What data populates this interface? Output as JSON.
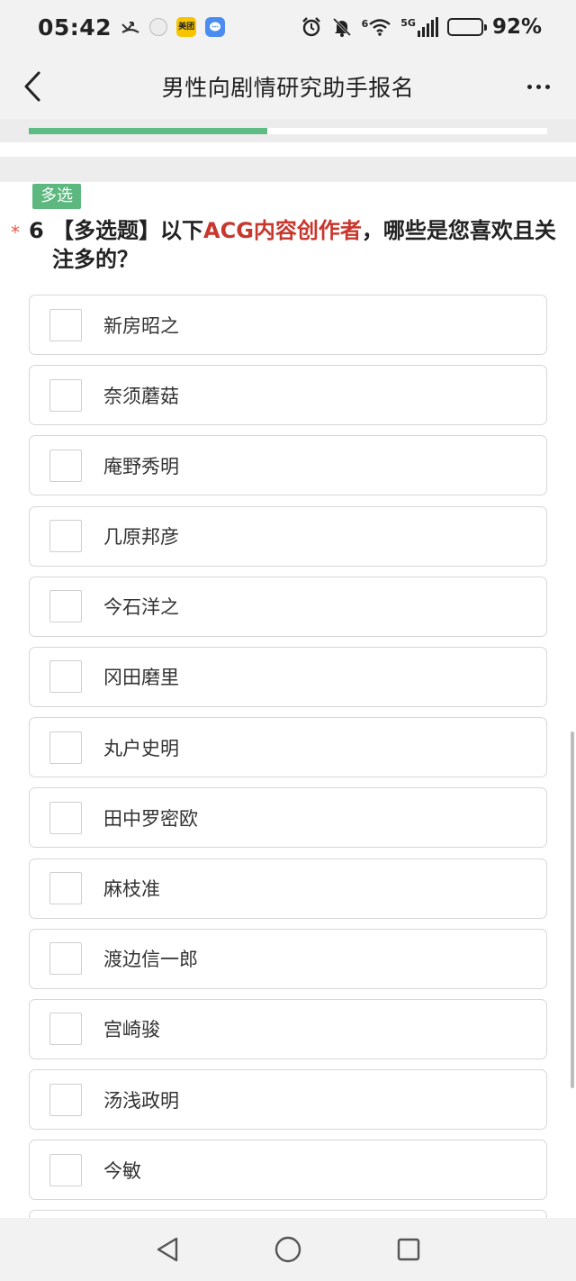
{
  "status_bar": {
    "time": "05:42",
    "app_icon_meituan": "美团",
    "net_speed": "6",
    "network": "5G",
    "battery_pct": "92%",
    "battery_level": 0.92,
    "icons": [
      "missed-call-icon",
      "circle-app-icon",
      "meituan-app-icon",
      "message-app-icon",
      "alarm-icon",
      "mute-icon",
      "wifi-icon",
      "signal-icon",
      "battery-icon"
    ]
  },
  "header": {
    "title": "男性向剧情研究助手报名",
    "icons": [
      "back-arrow-icon",
      "more-dots-icon"
    ]
  },
  "progress": {
    "fraction": 0.46,
    "color": "#5dbb83"
  },
  "question": {
    "tag": "多选",
    "required_mark": "*",
    "number": "6",
    "title_prefix": "【多选题】以下",
    "title_highlight": "ACG内容创作者",
    "title_suffix": "，哪些是您喜欢且关注多的？",
    "highlight_color": "#c8372d",
    "options": [
      {
        "label": "新房昭之"
      },
      {
        "label": "奈须蘑菇"
      },
      {
        "label": "庵野秀明"
      },
      {
        "label": "几原邦彦"
      },
      {
        "label": "今石洋之"
      },
      {
        "label": "冈田磨里"
      },
      {
        "label": "丸户史明"
      },
      {
        "label": "田中罗密欧"
      },
      {
        "label": "麻枝准"
      },
      {
        "label": "渡边信一郎"
      },
      {
        "label": "宫崎骏"
      },
      {
        "label": "汤浅政明"
      },
      {
        "label": "今敏"
      },
      {
        "label": ""
      }
    ]
  },
  "nav": {
    "icons": [
      "back-triangle-icon",
      "home-circle-icon",
      "recents-square-icon"
    ]
  },
  "colors": {
    "accent": "#5cb87f",
    "required": "#e15a4d",
    "border": "#d7d7d7"
  }
}
